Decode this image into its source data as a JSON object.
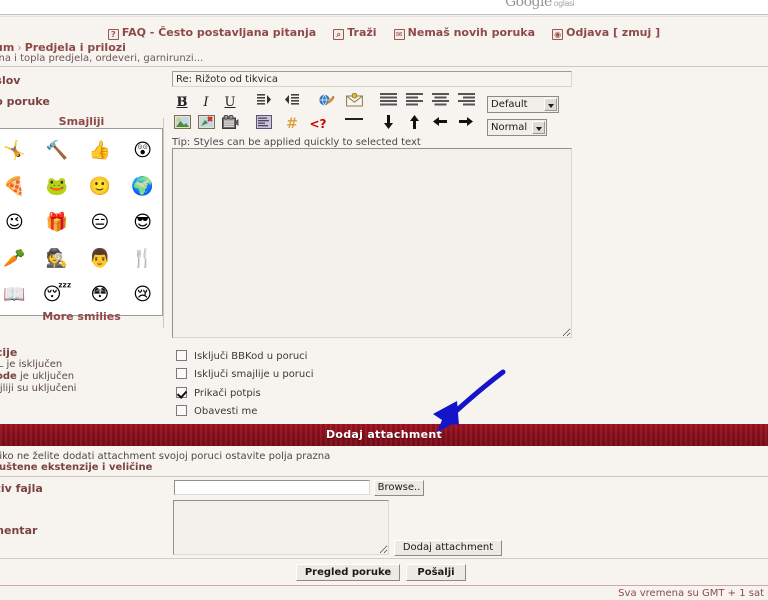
{
  "ads": {
    "logo": "Google",
    "sub": "oglasi"
  },
  "nav": {
    "links": [
      {
        "icon": "question-mark-icon",
        "glyph": "?",
        "label": "FAQ - Često postavljana pitanja"
      },
      {
        "icon": "search-icon",
        "glyph": "⌕",
        "label": "Traži"
      },
      {
        "icon": "envelope-icon",
        "glyph": "✉",
        "label": "Nemaš novih poruka"
      },
      {
        "icon": "logout-icon",
        "glyph": "◉",
        "label": "Odjava [ zmuj ]"
      }
    ]
  },
  "breadcrumb": {
    "root": "orum",
    "separator": "›",
    "current": "Predjela i prilozi",
    "description": "adna i topla predjela, ordeveri, garnirunzi..."
  },
  "form": {
    "subject_label": "aslov",
    "subject_value": "Re: Rižoto od tikvica",
    "body_label": "elo poruke",
    "body_value": "",
    "tip": "Tip: Styles can be applied quickly to selected text",
    "font_select": "Default",
    "size_select": "Normal"
  },
  "toolbar": {
    "buttons_row1": [
      {
        "name": "bold-button",
        "label": "B",
        "cls": "tb-b"
      },
      {
        "name": "italic-button",
        "label": "I",
        "cls": "tb-i"
      },
      {
        "name": "underline-button",
        "label": "U",
        "cls": "tb-u"
      },
      {
        "name": "quote-right-icon",
        "label": "",
        "cls": ""
      },
      {
        "name": "quote-left-icon",
        "label": "",
        "cls": ""
      },
      {
        "name": "url-link-icon",
        "label": "",
        "cls": ""
      },
      {
        "name": "email-icon",
        "label": "",
        "cls": ""
      },
      {
        "name": "align-justify-icon",
        "label": "",
        "cls": ""
      },
      {
        "name": "align-left-icon",
        "label": "",
        "cls": ""
      },
      {
        "name": "align-center-icon",
        "label": "",
        "cls": ""
      },
      {
        "name": "align-right-icon",
        "label": "",
        "cls": ""
      }
    ],
    "buttons_row2": [
      {
        "name": "image-icon",
        "label": "",
        "cls": ""
      },
      {
        "name": "flash-icon",
        "label": "",
        "cls": ""
      },
      {
        "name": "video-icon",
        "label": "",
        "cls": ""
      },
      {
        "name": "code-block-icon",
        "label": "",
        "cls": ""
      },
      {
        "name": "list-hash-icon",
        "label": "#",
        "cls": "tb-hash"
      },
      {
        "name": "php-code-icon",
        "label": "<?",
        "cls": "tb-php"
      },
      {
        "name": "horizontal-rule-icon",
        "label": "—",
        "cls": ""
      },
      {
        "name": "arrow-down-icon",
        "label": "↓",
        "cls": ""
      },
      {
        "name": "arrow-up-icon",
        "label": "↑",
        "cls": ""
      },
      {
        "name": "arrow-left-icon",
        "label": "←",
        "cls": ""
      },
      {
        "name": "arrow-right-icon",
        "label": "→",
        "cls": ""
      }
    ]
  },
  "smilies": {
    "title": "Smajliji",
    "more_label": "More smilies",
    "items": [
      {
        "name": "smiley-cheerleader",
        "glyph": "🤸"
      },
      {
        "name": "smiley-hammer",
        "glyph": "🔨"
      },
      {
        "name": "smiley-thumbs-up",
        "glyph": "👍"
      },
      {
        "name": "smiley-surprised",
        "glyph": "😲"
      },
      {
        "name": "smiley-chef-pizza",
        "glyph": "🍕"
      },
      {
        "name": "smiley-frog",
        "glyph": "🐸"
      },
      {
        "name": "smiley-happy",
        "glyph": "🙂"
      },
      {
        "name": "smiley-globe",
        "glyph": "🌍"
      },
      {
        "name": "smiley-wink",
        "glyph": "😉"
      },
      {
        "name": "smiley-gift",
        "glyph": "🎁"
      },
      {
        "name": "smiley-sleepy-flat",
        "glyph": "😑"
      },
      {
        "name": "smiley-cool-sunglasses",
        "glyph": "😎"
      },
      {
        "name": "smiley-carrot",
        "glyph": "🥕"
      },
      {
        "name": "smiley-detective",
        "glyph": "🕵"
      },
      {
        "name": "smiley-chef-hat",
        "glyph": "👨"
      },
      {
        "name": "smiley-cutlery",
        "glyph": "🍴"
      },
      {
        "name": "smiley-reading",
        "glyph": "📖"
      },
      {
        "name": "smiley-sleeping",
        "glyph": "😴"
      },
      {
        "name": "smiley-embarrassed",
        "glyph": "😳"
      },
      {
        "name": "smiley-crying",
        "glyph": "😢"
      }
    ]
  },
  "options": {
    "label": "pcije",
    "notes": [
      {
        "prefix": "",
        "bold": "",
        "text": "TML je isključen"
      },
      {
        "prefix": "",
        "bold": "BCode",
        "text": " je uključen"
      },
      {
        "prefix": "",
        "bold": "",
        "text": "majliji su uključeni"
      }
    ],
    "checkboxes": [
      {
        "name": "disable-bbcode-checkbox",
        "label": "Isključi BBKod u poruci",
        "checked": false
      },
      {
        "name": "disable-smilies-checkbox",
        "label": "Isključi smajlije u poruci",
        "checked": false
      },
      {
        "name": "attach-signature-checkbox",
        "label": "Prikači potpis",
        "checked": true
      },
      {
        "name": "notify-me-checkbox",
        "label": "Obavesti me",
        "checked": false
      }
    ]
  },
  "attachment": {
    "bar_title": "Dodaj attachment",
    "note": "koliko ne želite dodati attachment svojoj poruci ostavite polja prazna",
    "note_bold": "opuštene ekstenzije i veličine",
    "filename_label": "aziv fajla",
    "filename_value": "",
    "browse_label": "Browse..",
    "comment_label": "omentar",
    "comment_value": "",
    "add_button": "Dodaj attachment"
  },
  "actions": {
    "preview": "Pregled poruke",
    "submit": "Pošalji"
  },
  "footer": {
    "timezone": "Sva vremena su GMT + 1 sat"
  },
  "annotation": {
    "name": "blue-arrow-annotation",
    "color": "#1414C8"
  }
}
